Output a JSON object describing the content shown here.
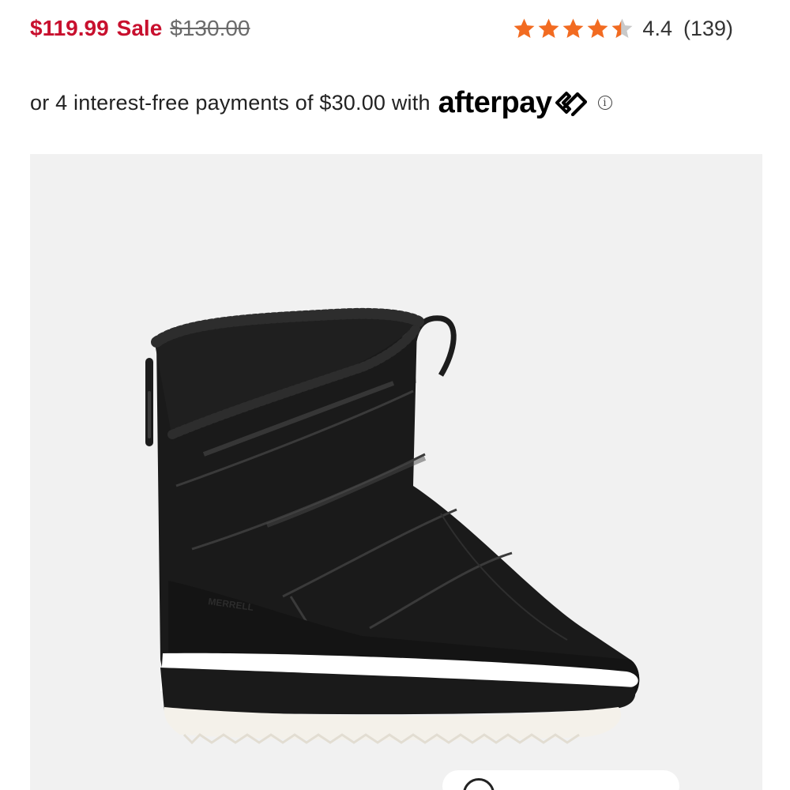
{
  "product": {
    "sale_price": "$119.99",
    "sale_label": "Sale",
    "original_price": "$130.00",
    "image_brand_text": "MERRELL"
  },
  "rating": {
    "value": "4.4",
    "count": "(139)",
    "stars_filled": 4.4,
    "stars_total": 5,
    "star_color": "#f26b21",
    "star_empty_color": "#c9c9c9"
  },
  "afterpay": {
    "text": "or 4 interest-free payments of $30.00 with",
    "brand": "afterpay",
    "info_icon": "info-icon"
  },
  "colors": {
    "sale_red": "#c8102e",
    "image_bg": "#f1f1f1"
  }
}
